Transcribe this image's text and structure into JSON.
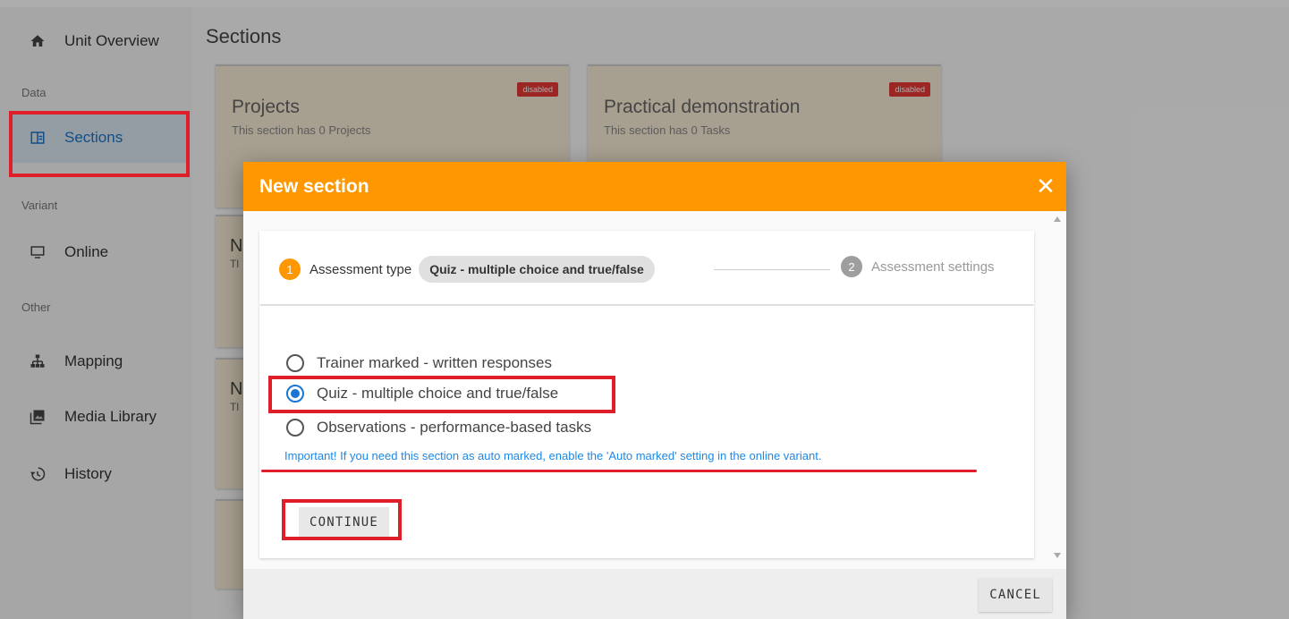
{
  "sidebar": {
    "items": [
      {
        "label": "Unit Overview",
        "icon": "home-icon"
      },
      {
        "label": "Sections",
        "icon": "sections-icon"
      },
      {
        "label": "Online",
        "icon": "monitor-icon"
      },
      {
        "label": "Mapping",
        "icon": "hierarchy-icon"
      },
      {
        "label": "Media Library",
        "icon": "media-library-icon"
      },
      {
        "label": "History",
        "icon": "history-icon"
      }
    ],
    "subheaders": {
      "data": "Data",
      "variant": "Variant",
      "other": "Other"
    }
  },
  "main": {
    "title": "Sections",
    "cards": [
      {
        "title": "Projects",
        "subtitle": "This section has 0 Projects",
        "badge": "disabled"
      },
      {
        "title": "Practical demonstration",
        "subtitle": "This section has 0 Tasks",
        "badge": "disabled"
      }
    ],
    "peek_cards": [
      {
        "letter": "N",
        "sub": "Tl"
      },
      {
        "letter": "N",
        "sub": "Tl"
      }
    ]
  },
  "dialog": {
    "title": "New section",
    "close_icon": "close-icon",
    "stepper": {
      "step1": {
        "number": "1",
        "label": "Assessment type",
        "chip": "Quiz - multiple choice and true/false"
      },
      "step2": {
        "number": "2",
        "label": "Assessment settings"
      }
    },
    "options": [
      {
        "label": "Trainer marked - written responses",
        "checked": false
      },
      {
        "label": "Quiz - multiple choice and true/false",
        "checked": true
      },
      {
        "label": "Observations - performance-based tasks",
        "checked": false
      }
    ],
    "note": "Important! If you need this section as auto marked, enable the 'Auto marked' setting in the online variant.",
    "continue_label": "CONTINUE",
    "cancel_label": "CANCEL"
  },
  "colors": {
    "header": "#ff9800",
    "highlight": "#e01e2a",
    "accent": "#1976d2"
  }
}
